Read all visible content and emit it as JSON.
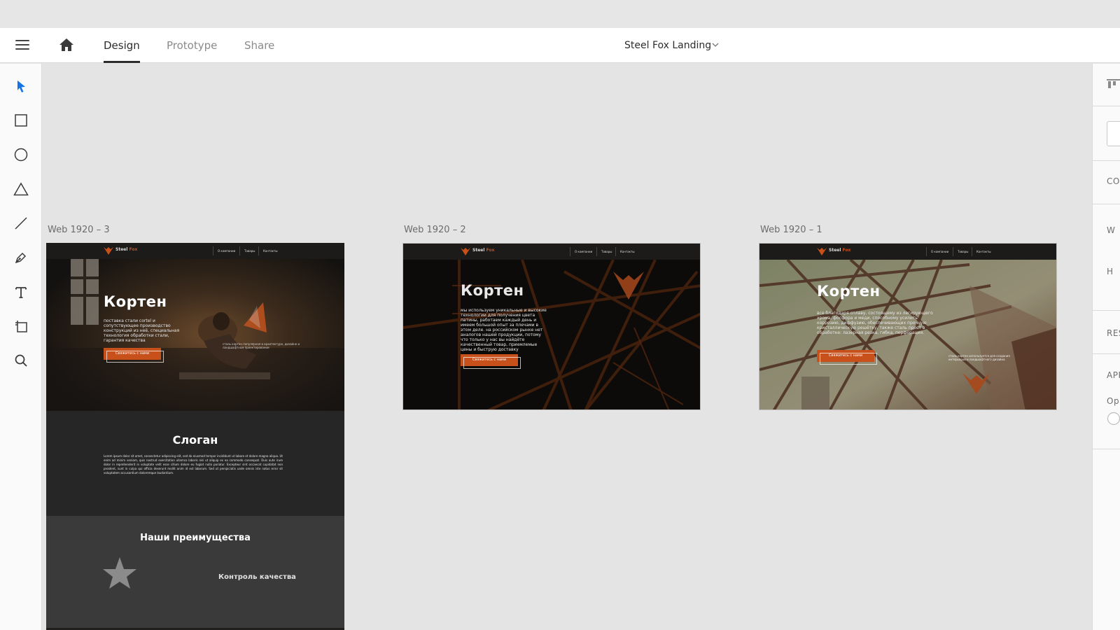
{
  "app": {
    "menu_icon": "hamburger-icon",
    "home_icon": "home-icon",
    "tabs": [
      {
        "label": "Design",
        "active": true
      },
      {
        "label": "Prototype",
        "active": false
      },
      {
        "label": "Share",
        "active": false
      }
    ],
    "document_title": "Steel Fox Landing"
  },
  "toolbar": {
    "tools": [
      "select-icon",
      "rectangle-icon",
      "ellipse-icon",
      "polygon-icon",
      "line-icon",
      "pen-icon",
      "text-icon",
      "artboard-icon",
      "zoom-icon"
    ],
    "accent": "#1473e6"
  },
  "right_panel": {
    "labels": [
      "CO",
      "W",
      "H",
      "RES",
      "APP",
      "Opa"
    ]
  },
  "artboards": [
    {
      "label": "Web 1920 – 3",
      "logo": [
        "Steel",
        "Fox"
      ],
      "nav": [
        "О компании",
        "Товары",
        "Контакты"
      ],
      "hero_title": "Кортен",
      "hero_text": "поставка стали cortel и сопутствующее производство конструкций из неё, специальная технология обработки стали, гарантия качества",
      "button": "Свяжитесь с нами",
      "aside": "сталь кортен популярная в архитектуре, дизайне и ландшафтном проектировании",
      "slogan_title": "Слоган",
      "slogan_text": "Lorem ipsum dolor sit amet, consectetur adipiscing elit, sed do eiusmod tempor incididunt ut labore et dolore magna aliqua. Ut enim ad minim veniam, quis nostrud exercitation ullamco laboris nisi ut aliquip ex ea commodo consequat. Duis aute irure dolor in reprehenderit in voluptate velit esse cillum dolore eu fugiat nulla pariatur. Excepteur sint occaecat cupidatat non proident, sunt in culpa qui officia deserunt mollit anim id est laborum. Sed ut perspiciatis unde omnis iste natus error sit voluptatem accusantium doloremque laudantium.",
      "advantages_title": "Наши преимущества",
      "advantage_item": "Контроль качества",
      "star_icon": "star-icon"
    },
    {
      "label": "Web 1920 – 2",
      "logo": [
        "Steel",
        "Fox"
      ],
      "nav": [
        "О компании",
        "Товары",
        "Контакты"
      ],
      "hero_title": "Кортен",
      "hero_text": "мы используем уникальные и высокие технологии для получения цвета патины, работаем каждый день и имеем большой опыт за плечами в этом деле. на российском рынке нет аналогов нашей продукции, потому что только у нас вы найдёте качественный товар, приемлемые цены и быструю доставку",
      "button": "Свяжитесь с нами"
    },
    {
      "label": "Web 1920 – 1",
      "logo": [
        "Steel",
        "Fox"
      ],
      "nav": [
        "О компании",
        "Товары",
        "Контакты"
      ],
      "hero_title": "Кортен",
      "hero_text": "все благодаря сплаву, состоящему из легирующего хрома, фосфора и меди, способному усилить коррозию, диффузию, обеспечивающих прочную кристаллическую решётку, также сталь прост в обработке: лазерная резка, гибка, перфорация.",
      "button": "Свяжитесь с нами",
      "aside": "сталь кортен используется для создания интерьеров и ландшафтного дизайна"
    }
  ]
}
